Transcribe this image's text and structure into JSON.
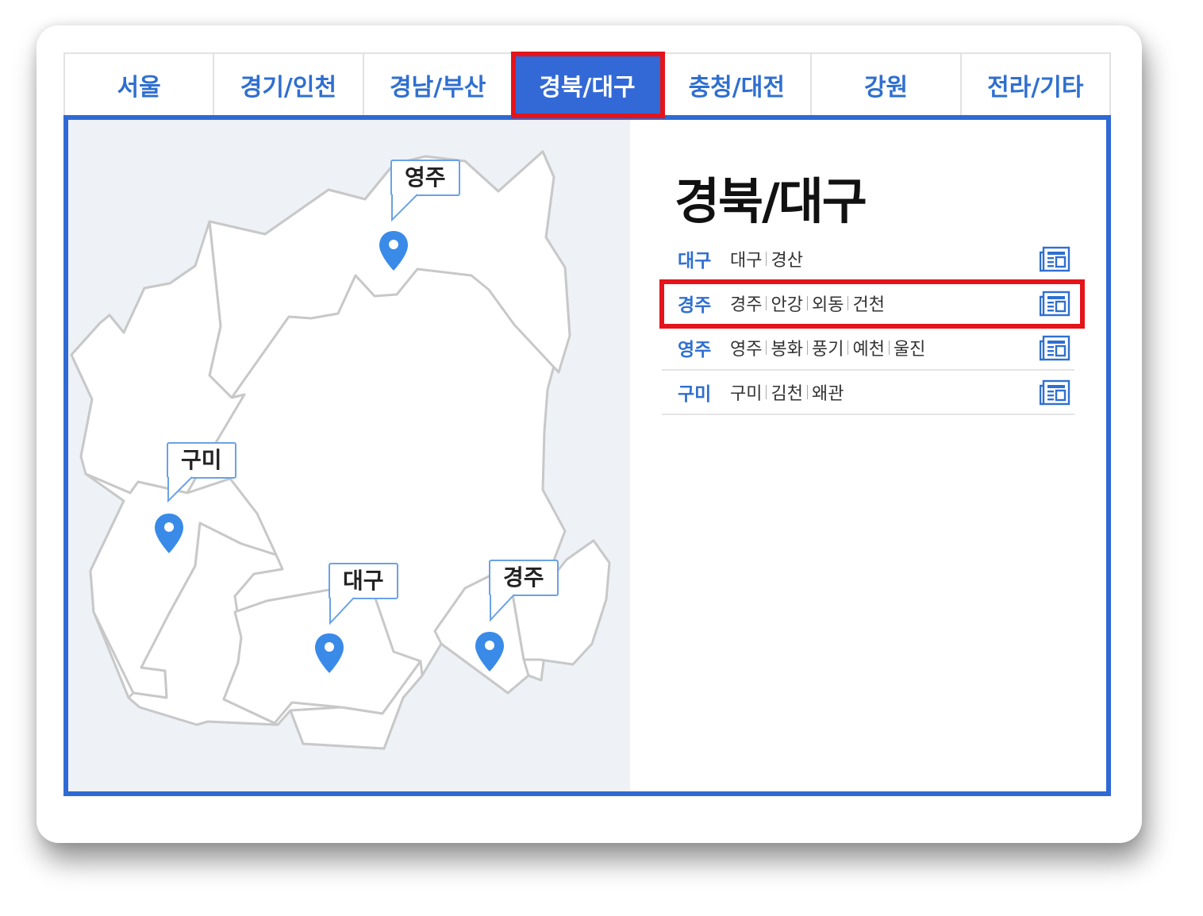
{
  "tabs": [
    {
      "label": "서울"
    },
    {
      "label": "경기/인천"
    },
    {
      "label": "경남/부산"
    },
    {
      "label": "경북/대구",
      "active": true
    },
    {
      "label": "충청/대전"
    },
    {
      "label": "강원"
    },
    {
      "label": "전라/기타"
    }
  ],
  "region_title": "경북/대구",
  "map": {
    "markers": [
      {
        "label": "영주"
      },
      {
        "label": "구미"
      },
      {
        "label": "대구"
      },
      {
        "label": "경주"
      }
    ],
    "marker_color": "#3a8ae8"
  },
  "branches": [
    {
      "city": "대구",
      "subs": [
        "대구",
        "경산"
      ],
      "icon": "document-icon"
    },
    {
      "city": "경주",
      "subs": [
        "경주",
        "안강",
        "외동",
        "건천"
      ],
      "icon": "document-icon",
      "highlighted": true
    },
    {
      "city": "영주",
      "subs": [
        "영주",
        "봉화",
        "풍기",
        "예천",
        "울진"
      ],
      "icon": "document-icon"
    },
    {
      "city": "구미",
      "subs": [
        "구미",
        "김천",
        "왜관"
      ],
      "icon": "document-icon"
    }
  ],
  "colors": {
    "accent": "#3369d6",
    "highlight": "#e4141a",
    "text_blue": "#2f6fd0"
  }
}
